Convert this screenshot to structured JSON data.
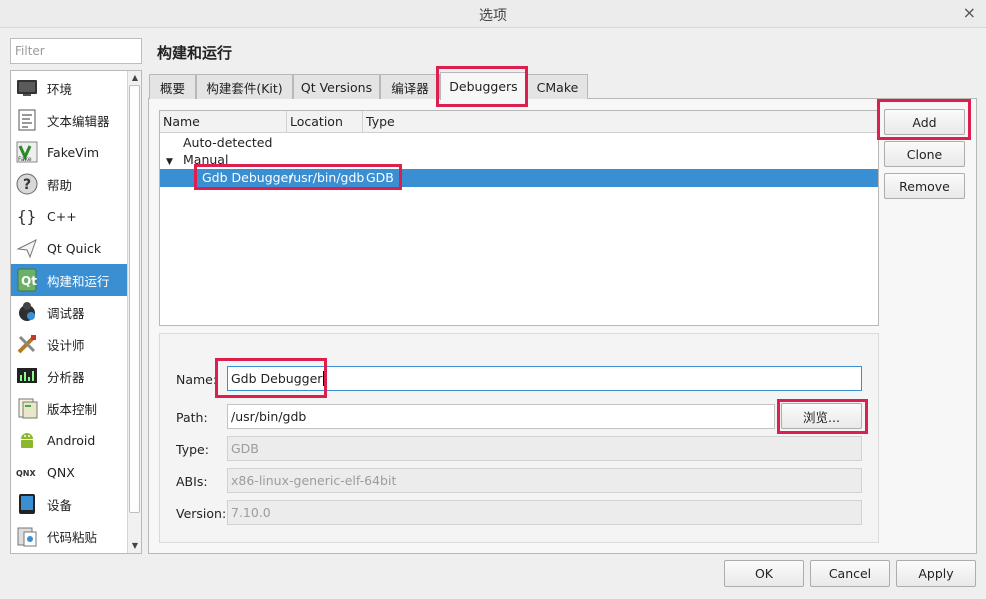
{
  "window": {
    "title": "选项",
    "close_glyph": "×"
  },
  "filter": {
    "placeholder": "Filter",
    "value": ""
  },
  "page_heading": "构建和运行",
  "sidebar": {
    "items": [
      {
        "label": "环境",
        "icon": "monitor-icon"
      },
      {
        "label": "文本编辑器",
        "icon": "text-document-icon"
      },
      {
        "label": "FakeVim",
        "icon": "fakevim-icon"
      },
      {
        "label": "帮助",
        "icon": "help-icon"
      },
      {
        "label": "C++",
        "icon": "cpp-braces-icon"
      },
      {
        "label": "Qt Quick",
        "icon": "paper-plane-icon"
      },
      {
        "label": "构建和运行",
        "icon": "qt-build-icon",
        "selected": true
      },
      {
        "label": "调试器",
        "icon": "debugger-bug-icon"
      },
      {
        "label": "设计师",
        "icon": "designer-tools-icon"
      },
      {
        "label": "分析器",
        "icon": "analyzer-icon"
      },
      {
        "label": "版本控制",
        "icon": "version-control-icon"
      },
      {
        "label": "Android",
        "icon": "android-icon"
      },
      {
        "label": "QNX",
        "icon": "qnx-icon"
      },
      {
        "label": "设备",
        "icon": "device-icon"
      },
      {
        "label": "代码粘贴",
        "icon": "code-paste-icon"
      }
    ]
  },
  "tabs": [
    {
      "label": "概要"
    },
    {
      "label": "构建套件(Kit)"
    },
    {
      "label": "Qt Versions"
    },
    {
      "label": "编译器"
    },
    {
      "label": "Debuggers",
      "active": true
    },
    {
      "label": "CMake"
    }
  ],
  "debugger_list": {
    "columns": [
      "Name",
      "Location",
      "Type"
    ],
    "groups": {
      "auto": "Auto-detected",
      "manual": "Manual"
    },
    "selected_row": {
      "name": "Gdb Debugger",
      "location": "/usr/bin/gdb",
      "type": "GDB"
    }
  },
  "side_buttons": {
    "add": "Add",
    "clone": "Clone",
    "remove": "Remove"
  },
  "details": {
    "name_label": "Name:",
    "name_value": "Gdb Debugger",
    "path_label": "Path:",
    "path_value": "/usr/bin/gdb",
    "browse_label": "浏览...",
    "type_label": "Type:",
    "type_value": "GDB",
    "abis_label": "ABIs:",
    "abis_value": "x86-linux-generic-elf-64bit",
    "version_label": "Version:",
    "version_value": "7.10.0"
  },
  "footer": {
    "ok": "OK",
    "cancel": "Cancel",
    "apply": "Apply"
  },
  "colors": {
    "selection": "#3a8fd2",
    "highlight_box": "#dc1f4e"
  }
}
